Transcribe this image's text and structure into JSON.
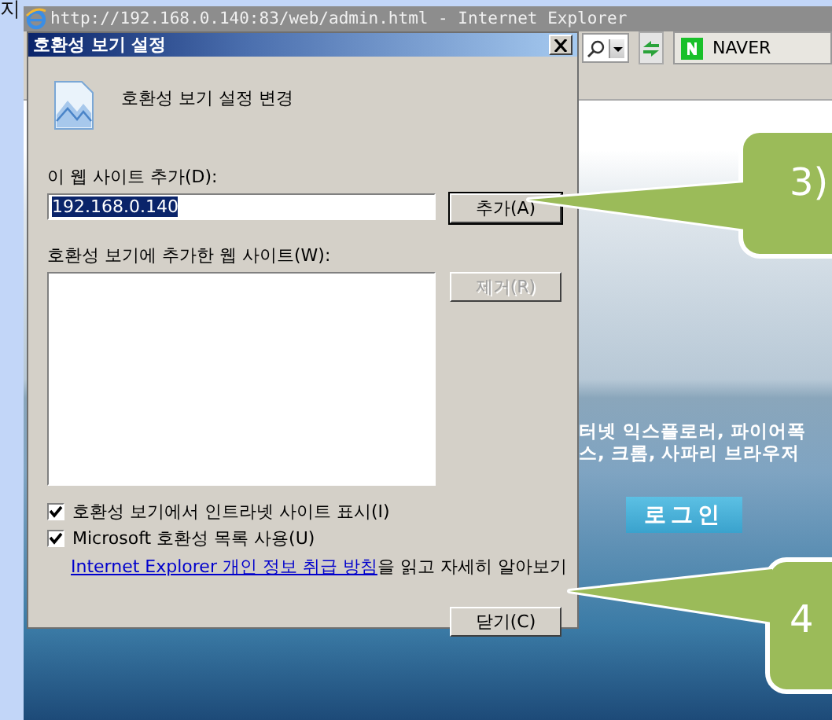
{
  "desktop": {
    "corner_text": "지"
  },
  "browser": {
    "title": "http://192.168.0.140:83/web/admin.html - Internet Explorer",
    "toolbar": {
      "naver_tab": "NAVER"
    },
    "page": {
      "notice_lines": [
        "터넷 익스플로러, 파이어폭",
        "스, 크롬, 사파리 브라우저"
      ],
      "login_button": "로그인"
    }
  },
  "dialog": {
    "title": "호환성 보기 설정",
    "heading": "호환성 보기 설정 변경",
    "add_label": "이 웹 사이트 추가(D):",
    "address_value": "192.168.0.140",
    "add_button": {
      "label": "추가(A)",
      "disabled": false
    },
    "list_label": "호환성 보기에 추가한 웹 사이트(W):",
    "remove_button": {
      "label": "제거(R)",
      "disabled": true
    },
    "options": [
      {
        "label": "호환성 보기에서 인트라넷 사이트 표시(I)",
        "checked": true
      },
      {
        "label": "Microsoft 호환성 목록 사용(U)",
        "checked": true
      }
    ],
    "privacy_link": "Internet Explorer 개인 정보 취급 방침",
    "privacy_text": "을 읽고 자세히 알아보기",
    "close_button": "닫기(C)"
  },
  "callouts": [
    {
      "label": "3)"
    },
    {
      "label": "4"
    }
  ]
}
